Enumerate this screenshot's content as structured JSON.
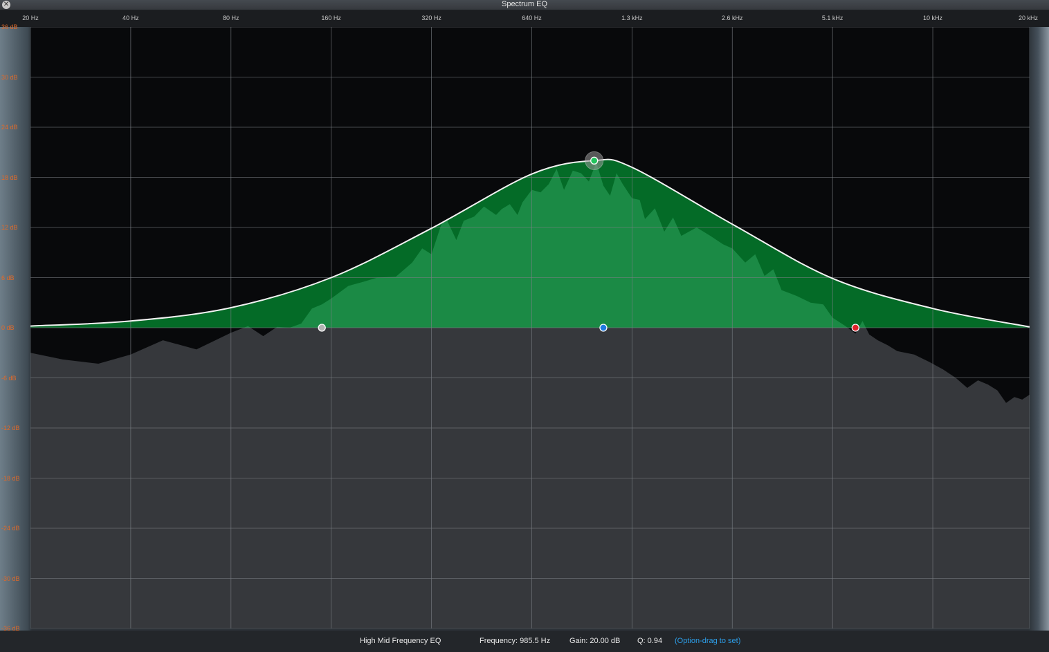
{
  "window": {
    "title": "Spectrum EQ",
    "close_icon": "close-icon"
  },
  "chart_data": {
    "type": "area",
    "x_scale": "log",
    "xlim": [
      20,
      20000
    ],
    "ylim": [
      -36,
      36
    ],
    "x_tick_labels": [
      {
        "hz": 20,
        "label": "20 Hz"
      },
      {
        "hz": 40,
        "label": "40 Hz"
      },
      {
        "hz": 80,
        "label": "80 Hz"
      },
      {
        "hz": 160,
        "label": "160 Hz"
      },
      {
        "hz": 320,
        "label": "320 Hz"
      },
      {
        "hz": 640,
        "label": "640 Hz"
      },
      {
        "hz": 1280,
        "label": "1.3 kHz"
      },
      {
        "hz": 2560,
        "label": "2.6 kHz"
      },
      {
        "hz": 5120,
        "label": "5.1 kHz"
      },
      {
        "hz": 10240,
        "label": "10 kHz"
      },
      {
        "hz": 20000,
        "label": "20 kHz"
      }
    ],
    "y_tick_labels": [
      {
        "db": 36,
        "label": "36 dB"
      },
      {
        "db": 30,
        "label": "30 dB"
      },
      {
        "db": 24,
        "label": "24 dB"
      },
      {
        "db": 18,
        "label": "18 dB"
      },
      {
        "db": 12,
        "label": "12 dB"
      },
      {
        "db": 6,
        "label": "6 dB"
      },
      {
        "db": 0,
        "label": "0 dB"
      },
      {
        "db": -6,
        "label": "-6 dB"
      },
      {
        "db": -12,
        "label": "-12 dB"
      },
      {
        "db": -18,
        "label": "-18 dB"
      },
      {
        "db": -24,
        "label": "-24 dB"
      },
      {
        "db": -30,
        "label": "-30 dB"
      },
      {
        "db": -36,
        "label": "-36 dB"
      }
    ],
    "grid": true,
    "eq_band": {
      "frequency_hz": 985.5,
      "gain_db": 20.0,
      "q": 0.94
    },
    "curve": {
      "x": [
        20,
        40,
        80,
        160,
        320,
        640,
        985.5,
        1280,
        2560,
        5120,
        10240,
        20000
      ],
      "y": [
        0.2,
        0.8,
        2.4,
        6.0,
        11.9,
        18.4,
        20.0,
        19.2,
        12.4,
        5.9,
        2.3,
        0.1
      ]
    },
    "spectrum": {
      "x": [
        20,
        25,
        32,
        40,
        50,
        63,
        80,
        90,
        100,
        110,
        120,
        130,
        140,
        150,
        160,
        180,
        200,
        220,
        250,
        280,
        300,
        320,
        350,
        380,
        400,
        430,
        460,
        500,
        520,
        550,
        580,
        600,
        640,
        680,
        720,
        760,
        800,
        850,
        900,
        950,
        1000,
        1050,
        1100,
        1150,
        1200,
        1280,
        1350,
        1400,
        1500,
        1600,
        1700,
        1800,
        2000,
        2200,
        2400,
        2560,
        2800,
        3000,
        3200,
        3400,
        3600,
        4000,
        4400,
        4800,
        5120,
        5600,
        6000,
        6300,
        6600,
        7000,
        7500,
        8000,
        9000,
        10000,
        11000,
        12000,
        13000,
        14000,
        15000,
        16000,
        17000,
        18000,
        19000,
        20000
      ],
      "y": [
        -3.0,
        -3.8,
        -4.3,
        -3.2,
        -1.5,
        -2.6,
        -0.6,
        0.2,
        -1.0,
        0.1,
        0.0,
        0.5,
        2.3,
        2.8,
        3.5,
        5.0,
        5.5,
        6.0,
        6.1,
        7.8,
        9.5,
        8.8,
        13.5,
        10.5,
        12.8,
        13.3,
        14.5,
        13.5,
        14.2,
        14.8,
        13.5,
        15.0,
        16.5,
        16.2,
        17.2,
        19.0,
        16.5,
        18.8,
        18.5,
        17.5,
        19.8,
        17.0,
        15.8,
        18.5,
        17.2,
        15.5,
        15.3,
        13.0,
        14.3,
        11.5,
        13.2,
        11.0,
        12.0,
        11.0,
        10.0,
        9.5,
        7.8,
        8.8,
        6.2,
        7.0,
        4.5,
        3.8,
        3.0,
        2.8,
        1.2,
        0.2,
        -0.7,
        0.8,
        -0.8,
        -1.5,
        -2.1,
        -2.8,
        -3.2,
        -4.1,
        -5.0,
        -6.0,
        -7.2,
        -6.3,
        -6.8,
        -7.5,
        -9.0,
        -8.3,
        -8.6,
        -8.0
      ]
    },
    "band_handles": [
      {
        "name": "low",
        "hz": 150,
        "db": 0,
        "color": "#b3b3b3"
      },
      {
        "name": "high-mid",
        "hz": 985.5,
        "db": 20.0,
        "color": "#22c55e"
      },
      {
        "name": "mid",
        "hz": 1050,
        "db": 0,
        "color": "#1f7ae0"
      },
      {
        "name": "high",
        "hz": 6000,
        "db": 0,
        "color": "#e0222a"
      }
    ],
    "colors": {
      "curve": "#f2f2f2",
      "eq_fill": "#046b27",
      "spectrum_above": "#1b8a45",
      "spectrum_below": "#36383c",
      "background": "#08090b",
      "grid": "#7c8086",
      "db_label": "#e06a2a"
    }
  },
  "status": {
    "band_name": "High Mid Frequency EQ",
    "frequency": "Frequency: 985.5 Hz",
    "gain": "Gain: 20.00 dB",
    "q": "Q: 0.94",
    "hint": "(Option-drag to set)"
  }
}
